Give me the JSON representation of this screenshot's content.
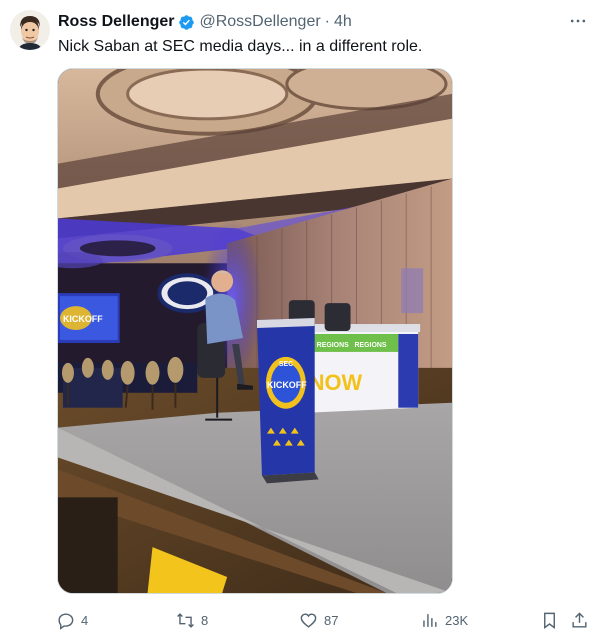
{
  "author": {
    "display_name": "Ross Dellenger",
    "handle": "@RossDellenger",
    "separator": "·",
    "time": "4h",
    "verified_icon": "verified-badge-icon",
    "avatar_icon": "avatar-illustration"
  },
  "more_icon": "more-dots-icon",
  "tweet_text": "Nick Saban at SEC media days... in a different role.",
  "media": {
    "kind": "photo",
    "signs": {
      "desk_now": "NOW",
      "desk_sponsor_left": "REGIONS",
      "desk_sponsor_right": "REGIONS",
      "podium_top": "SEC",
      "podium_main": "KICKOFF",
      "screen_text": "KICKOFF"
    }
  },
  "actions": {
    "replies": {
      "icon": "reply-icon",
      "count": "4"
    },
    "reposts": {
      "icon": "repost-icon",
      "count": "8"
    },
    "likes": {
      "icon": "heart-icon",
      "count": "87"
    },
    "views": {
      "icon": "views-icon",
      "count": "23K"
    },
    "bookmark": {
      "icon": "bookmark-icon"
    },
    "share": {
      "icon": "share-icon"
    }
  },
  "colors": {
    "text_primary": "#0f1419",
    "text_secondary": "#536471",
    "verified_blue": "#1d9bf0",
    "border": "#cfd9de"
  }
}
